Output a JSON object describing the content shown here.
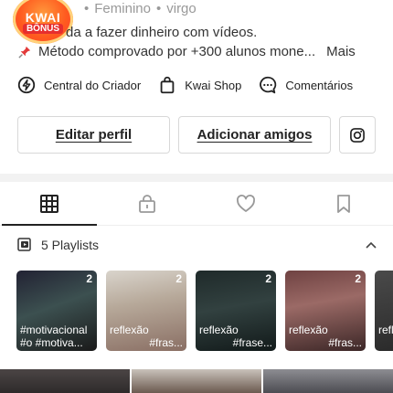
{
  "badge": {
    "line1": "KWAI",
    "line2": "BÔNUS"
  },
  "profile": {
    "gender": "Feminino",
    "sign": "virgo"
  },
  "bio": {
    "line1": "da a fazer dinheiro com vídeos.",
    "line2": "Método comprovado por +300 alunos mone...",
    "more": "Mais"
  },
  "links": {
    "creator": "Central do Criador",
    "shop": "Kwai Shop",
    "comments": "Comentários"
  },
  "buttons": {
    "edit": "Editar perfil",
    "add": "Adicionar amigos"
  },
  "playlists": {
    "label": "5 Playlists",
    "items": [
      {
        "count": "2",
        "tag1": "#motivacional",
        "tag2": "#o #motiva..."
      },
      {
        "count": "2",
        "tag1": "reflexão",
        "tag2": "#fras..."
      },
      {
        "count": "2",
        "tag1": "reflexão",
        "tag2": "#frase..."
      },
      {
        "count": "2",
        "tag1": "reflexão",
        "tag2": "#fras..."
      },
      {
        "tag1": "refle"
      }
    ]
  },
  "colors": {
    "badge": "#ff5a1f",
    "text": "#222222",
    "muted": "#999999"
  }
}
